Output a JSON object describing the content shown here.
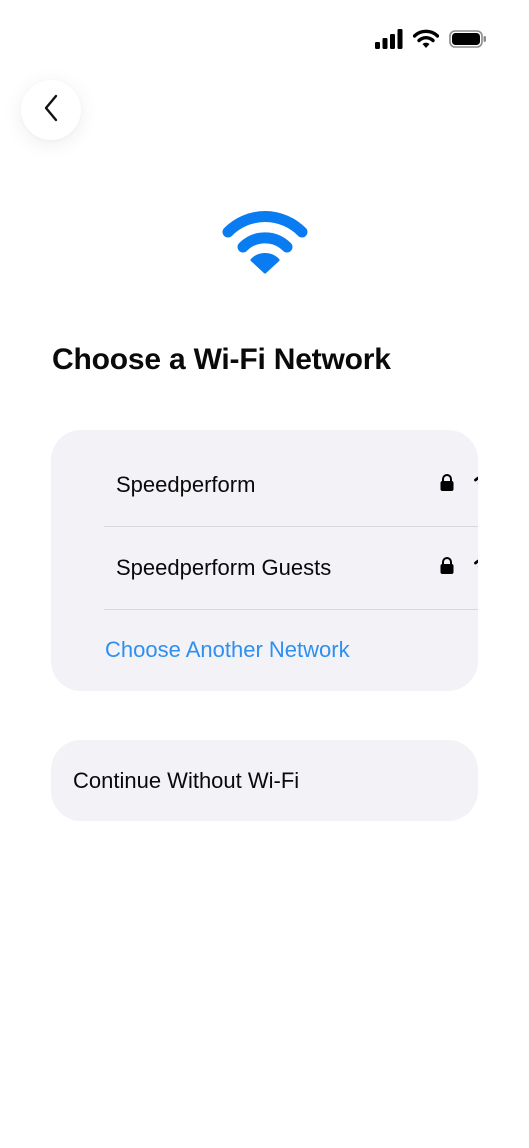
{
  "status_bar": {
    "icons": [
      "cellular-signal-icon",
      "wifi-icon",
      "battery-icon"
    ]
  },
  "navigation": {
    "back_icon": "chevron-left-icon"
  },
  "hero": {
    "icon": "wifi-icon",
    "color": "#0a7cf2"
  },
  "title": "Choose a Wi-Fi Network",
  "networks": [
    {
      "name": "Speedperform",
      "locked": true,
      "icons": [
        "lock-icon",
        "wifi-signal-icon"
      ]
    },
    {
      "name": "Speedperform Guests",
      "locked": true,
      "icons": [
        "lock-icon",
        "wifi-signal-icon"
      ]
    }
  ],
  "choose_another": "Choose Another Network",
  "continue_without": "Continue Without Wi-Fi",
  "colors": {
    "accent": "#2f8ff0",
    "card_background": "#f2f2f7",
    "text": "#0a0a0a"
  }
}
